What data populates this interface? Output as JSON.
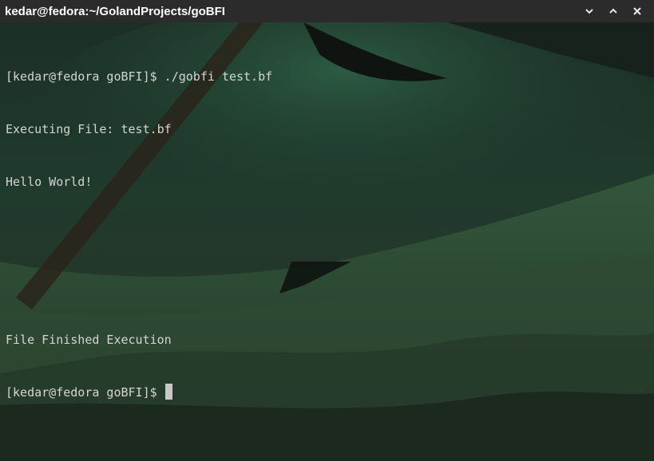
{
  "window": {
    "title": "kedar@fedora:~/GolandProjects/goBFI",
    "controls": [
      {
        "icon": "chevron-down-icon"
      },
      {
        "icon": "chevron-up-icon"
      },
      {
        "icon": "close-icon"
      }
    ]
  },
  "terminal": {
    "lines": [
      "[kedar@fedora goBFI]$ ./gobfi test.bf",
      "Executing File: test.bf",
      "Hello World!",
      "",
      "",
      "File Finished Execution"
    ],
    "prompt": "[kedar@fedora goBFI]$"
  },
  "colors": {
    "titlebar_bg": "#2b2b2b",
    "text": "#d2d6d2",
    "cursor": "#c8c8c8"
  }
}
